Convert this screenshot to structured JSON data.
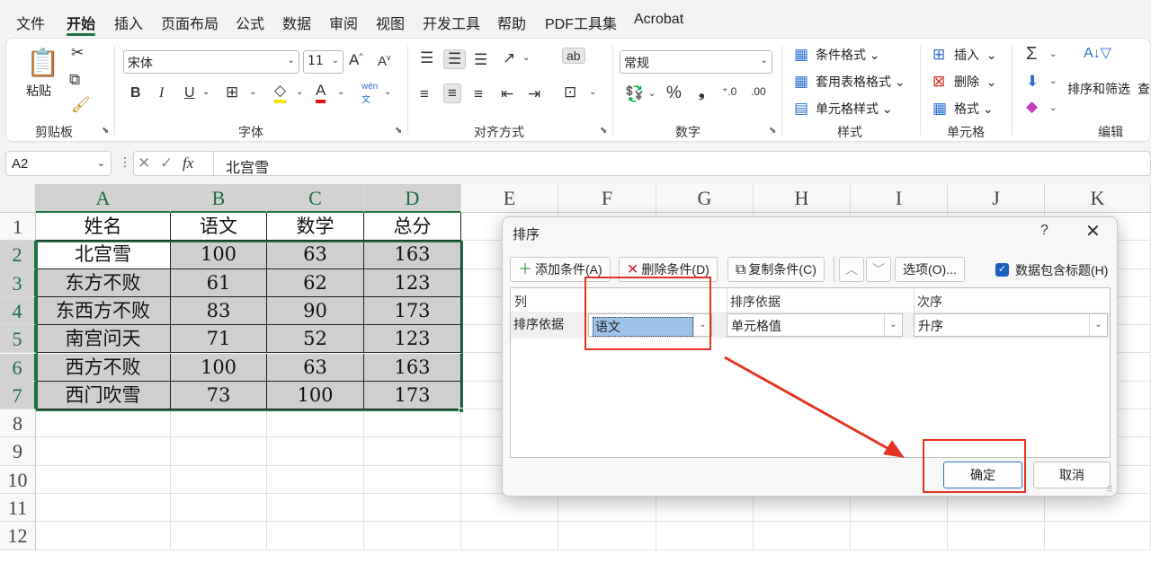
{
  "menu": {
    "tabs": [
      "文件",
      "开始",
      "插入",
      "页面布局",
      "公式",
      "数据",
      "审阅",
      "视图",
      "开发工具",
      "帮助",
      "PDF工具集",
      "Acrobat"
    ],
    "active": "开始"
  },
  "ribbon": {
    "clipboard": {
      "label": "剪贴板",
      "paste": "粘贴"
    },
    "font": {
      "label": "字体",
      "name": "宋体",
      "size": "11",
      "phonetic": "wén"
    },
    "alignment": {
      "label": "对齐方式"
    },
    "number": {
      "label": "数字",
      "format": "常规"
    },
    "styles": {
      "label": "样式",
      "conditional": "条件格式",
      "table_format": "套用表格格式",
      "cell_styles": "单元格样式"
    },
    "cells": {
      "label": "单元格",
      "insert": "插入",
      "delete": "删除",
      "format": "格式"
    },
    "editing": {
      "label": "编辑",
      "sort_filter": "排序和筛选",
      "find": "查"
    }
  },
  "formula_bar": {
    "name_box": "A2",
    "fx": "fx",
    "value": "北宫雪"
  },
  "sheet": {
    "columns": [
      "A",
      "B",
      "C",
      "D",
      "E",
      "F",
      "G",
      "H",
      "I",
      "J",
      "K"
    ],
    "rows": [
      "1",
      "2",
      "3",
      "4",
      "5",
      "6",
      "7",
      "8",
      "9",
      "10",
      "11",
      "12"
    ],
    "header": [
      "姓名",
      "语文",
      "数学",
      "总分"
    ],
    "data": [
      [
        "北宫雪",
        "100",
        "63",
        "163"
      ],
      [
        "东方不败",
        "61",
        "62",
        "123"
      ],
      [
        "东西方不败",
        "83",
        "90",
        "173"
      ],
      [
        "南宫问天",
        "71",
        "52",
        "123"
      ],
      [
        "西方不败",
        "100",
        "63",
        "163"
      ],
      [
        "西门吹雪",
        "73",
        "100",
        "173"
      ]
    ]
  },
  "dialog": {
    "title": "排序",
    "help": "?",
    "add_level": "添加条件(A)",
    "delete_level": "删除条件(D)",
    "copy_level": "复制条件(C)",
    "options": "选项(O)...",
    "has_headers": "数据包含标题(H)",
    "col_header": "列",
    "sort_on_header": "排序依据",
    "order_header": "次序",
    "row_label": "排序依据",
    "column_value": "语文",
    "sort_on_value": "单元格值",
    "order_value": "升序",
    "ok": "确定",
    "cancel": "取消"
  },
  "colors": {
    "accent": "#1e7145",
    "annotation": "#e53323",
    "shade": "#cfcfcf"
  }
}
